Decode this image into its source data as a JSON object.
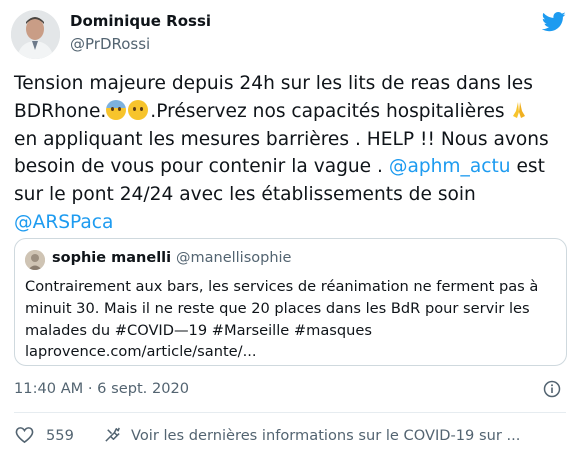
{
  "author": {
    "name": "Dominique Rossi",
    "handle": "@PrDRossi"
  },
  "tweet": {
    "line1": "Tension majeure depuis 24h sur les lits de reas dans les",
    "line2_prefix": "BDRhone.",
    "line2_suffix": ".Préservez nos capacités hospitalières",
    "line3": "en appliquant les mesures barrières . HELP !! Nous avons",
    "line4_prefix": "besoin de vous pour contenir la vague . ",
    "line4_mention": "@aphm_actu",
    "line4_suffix": " est",
    "line5": "sur le pont 24/24 avec les établissements de soin",
    "line6_mention": "@ARSPaca",
    "emojis": [
      "anxious-face-with-sweat-icon",
      "sad-relieved-face-icon",
      "folded-hands-icon"
    ]
  },
  "quoted": {
    "name": "sophie manelli",
    "handle": "@manellisophie",
    "line1": "Contrairement aux bars, les services de réanimation ne ferment pas à",
    "line2": "minuit 30. Mais il ne reste que 20 places dans les BdR pour servir les",
    "line3": "malades du #COVID—19 #Marseille #masques",
    "line4": "laprovence.com/article/sante/..."
  },
  "timestamp": "11:40 AM · 6 sept. 2020",
  "actions": {
    "like_count": "559",
    "covid_info": "Voir les dernières informations sur le COVID-19 sur ..."
  },
  "colors": {
    "accent": "#1d9bf0",
    "text": "#0f1419",
    "secondary": "#536471",
    "border": "#cfd9de"
  }
}
